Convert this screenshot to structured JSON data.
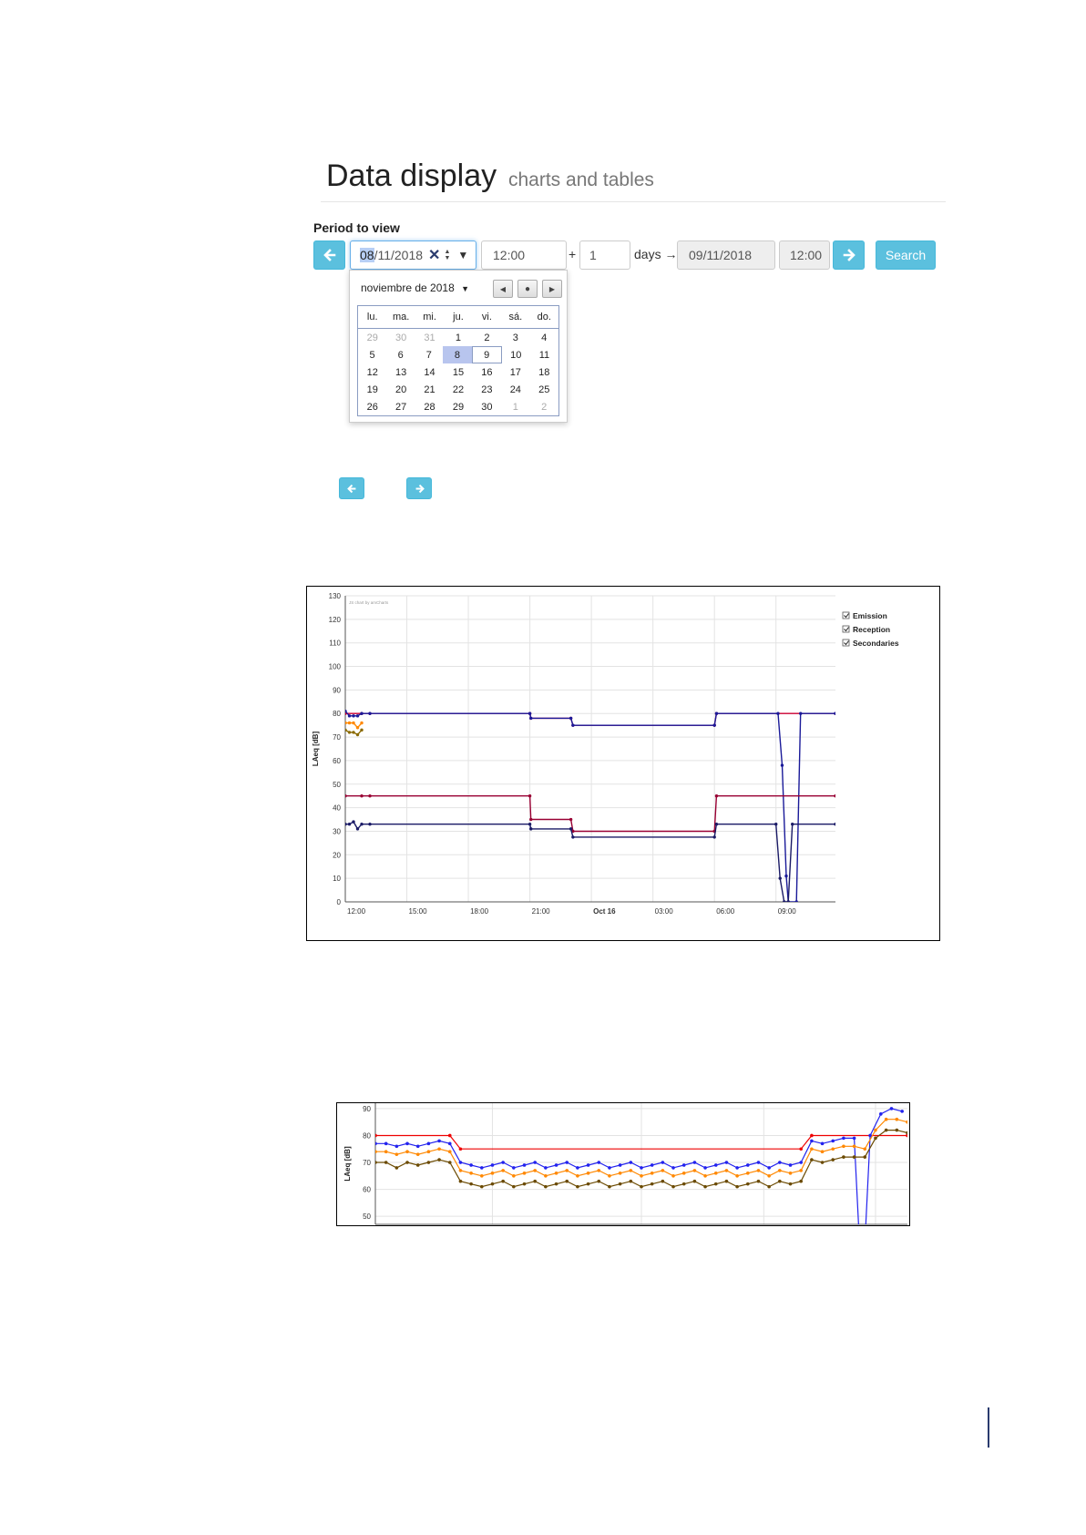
{
  "header": {
    "title": "Data display",
    "subtitle": "charts and tables"
  },
  "period": {
    "label": "Period to view",
    "start_date_prefix": "08",
    "start_date_rest": "/11/2018",
    "start_time": "12:00",
    "plus": "+",
    "days_value": "1",
    "days_label": "days",
    "arrow": "→",
    "end_date": "09/11/2018",
    "end_time": "12:00",
    "search_label": "Search",
    "prev_icon": "arrow-left-icon",
    "next_icon": "arrow-right-icon",
    "accent_color": "#5bc0de"
  },
  "datepicker": {
    "month_label": "noviembre de 2018",
    "weekdays": [
      "lu.",
      "ma.",
      "mi.",
      "ju.",
      "vi.",
      "sá.",
      "do."
    ],
    "weeks": [
      [
        "29",
        "30",
        "31",
        "1",
        "2",
        "3",
        "4"
      ],
      [
        "5",
        "6",
        "7",
        "8",
        "9",
        "10",
        "11"
      ],
      [
        "12",
        "13",
        "14",
        "15",
        "16",
        "17",
        "18"
      ],
      [
        "19",
        "20",
        "21",
        "22",
        "23",
        "24",
        "25"
      ],
      [
        "26",
        "27",
        "28",
        "29",
        "30",
        "1",
        "2"
      ]
    ],
    "selected_day": "8",
    "highlighted_day": "9"
  },
  "chart_data": [
    {
      "type": "line",
      "title": "",
      "credit": "JS chart by amCharts",
      "ylabel": "LAeq [dB]",
      "ylim": [
        0,
        130
      ],
      "yticks": [
        0,
        10,
        20,
        30,
        40,
        50,
        60,
        70,
        80,
        90,
        100,
        110,
        120,
        130
      ],
      "xlim": [
        12.0,
        35.9
      ],
      "xticks": [
        {
          "x": 12,
          "label": "12:00"
        },
        {
          "x": 15,
          "label": "15:00"
        },
        {
          "x": 18,
          "label": "18:00"
        },
        {
          "x": 21,
          "label": "21:00"
        },
        {
          "x": 24,
          "label": "Oct 16"
        },
        {
          "x": 27,
          "label": "03:00"
        },
        {
          "x": 30,
          "label": "06:00"
        },
        {
          "x": 33,
          "label": "09:00"
        }
      ],
      "legend": [
        "Emission",
        "Reception",
        "Secondaries"
      ],
      "legend_position": "right",
      "grid": true,
      "series": [
        {
          "color": "#cc0033",
          "points": [
            [
              12.0,
              80
            ],
            [
              12.8,
              80
            ],
            [
              13.2,
              80
            ],
            [
              21.0,
              80
            ],
            [
              21.05,
              78
            ],
            [
              23.0,
              78
            ],
            [
              23.1,
              75
            ],
            [
              30.0,
              75
            ],
            [
              30.1,
              80
            ],
            [
              35.9,
              80
            ]
          ]
        },
        {
          "color": "#1a1a99",
          "points": [
            [
              12.0,
              81
            ],
            [
              12.2,
              79
            ],
            [
              12.4,
              79
            ],
            [
              12.6,
              79
            ],
            [
              12.8,
              80
            ],
            [
              13.2,
              80
            ],
            [
              21.0,
              80
            ],
            [
              21.05,
              78
            ],
            [
              23.0,
              78
            ],
            [
              23.1,
              75
            ],
            [
              30.0,
              75
            ],
            [
              30.1,
              80
            ],
            [
              33.1,
              80
            ],
            [
              33.3,
              58
            ],
            [
              33.5,
              11
            ],
            [
              33.6,
              0
            ],
            [
              34.0,
              0
            ],
            [
              34.2,
              80
            ],
            [
              35.9,
              80
            ]
          ]
        },
        {
          "color": "#ff8800",
          "points": [
            [
              12.0,
              76
            ],
            [
              12.2,
              76
            ],
            [
              12.4,
              76
            ],
            [
              12.6,
              74
            ],
            [
              12.8,
              76
            ]
          ]
        },
        {
          "color": "#8a6a00",
          "points": [
            [
              12.0,
              73
            ],
            [
              12.2,
              72
            ],
            [
              12.4,
              72
            ],
            [
              12.6,
              71
            ],
            [
              12.8,
              73
            ]
          ]
        },
        {
          "color": "#990033",
          "points": [
            [
              12.0,
              45
            ],
            [
              12.8,
              45
            ],
            [
              13.2,
              45
            ],
            [
              21.0,
              45
            ],
            [
              21.05,
              35
            ],
            [
              23.0,
              35
            ],
            [
              23.1,
              30
            ],
            [
              30.0,
              30
            ],
            [
              30.1,
              45
            ],
            [
              35.9,
              45
            ]
          ]
        },
        {
          "color": "#1a1a66",
          "points": [
            [
              12.0,
              33
            ],
            [
              12.2,
              33
            ],
            [
              12.4,
              34
            ],
            [
              12.6,
              31
            ],
            [
              12.8,
              33
            ],
            [
              13.2,
              33
            ],
            [
              21.0,
              33
            ],
            [
              21.05,
              31
            ],
            [
              23.0,
              31
            ],
            [
              23.1,
              27.5
            ],
            [
              30.0,
              27.5
            ],
            [
              30.1,
              33
            ],
            [
              33.0,
              33
            ],
            [
              33.2,
              10
            ],
            [
              33.4,
              0
            ],
            [
              33.6,
              0
            ],
            [
              33.8,
              33
            ],
            [
              35.9,
              33
            ]
          ]
        }
      ]
    },
    {
      "type": "line",
      "title": "",
      "ylabel": "LAeq [dB]",
      "ylim": [
        47,
        92
      ],
      "yticks": [
        50,
        60,
        70,
        80,
        90
      ],
      "xlim": [
        0,
        100
      ],
      "grid": true,
      "series": [
        {
          "color": "#ee0000",
          "points": [
            [
              0,
              80
            ],
            [
              14,
              80
            ],
            [
              16,
              75
            ],
            [
              80,
              75
            ],
            [
              82,
              80
            ],
            [
              100,
              80
            ]
          ]
        },
        {
          "color": "#2222ee",
          "points": [
            [
              0,
              77
            ],
            [
              2,
              77
            ],
            [
              4,
              76
            ],
            [
              6,
              77
            ],
            [
              8,
              76
            ],
            [
              10,
              77
            ],
            [
              12,
              78
            ],
            [
              14,
              77
            ],
            [
              16,
              70
            ],
            [
              18,
              69
            ],
            [
              20,
              68
            ],
            [
              22,
              69
            ],
            [
              24,
              70
            ],
            [
              26,
              68
            ],
            [
              28,
              69
            ],
            [
              30,
              70
            ],
            [
              32,
              68
            ],
            [
              34,
              69
            ],
            [
              36,
              70
            ],
            [
              38,
              68
            ],
            [
              40,
              69
            ],
            [
              42,
              70
            ],
            [
              44,
              68
            ],
            [
              46,
              69
            ],
            [
              48,
              70
            ],
            [
              50,
              68
            ],
            [
              52,
              69
            ],
            [
              54,
              70
            ],
            [
              56,
              68
            ],
            [
              58,
              69
            ],
            [
              60,
              70
            ],
            [
              62,
              68
            ],
            [
              64,
              69
            ],
            [
              66,
              70
            ],
            [
              68,
              68
            ],
            [
              70,
              69
            ],
            [
              72,
              70
            ],
            [
              74,
              68
            ],
            [
              76,
              70
            ],
            [
              78,
              69
            ],
            [
              80,
              70
            ],
            [
              82,
              78
            ],
            [
              84,
              77
            ],
            [
              86,
              78
            ],
            [
              88,
              79
            ],
            [
              90,
              79
            ],
            [
              91,
              40
            ],
            [
              92,
              40
            ],
            [
              93,
              80
            ],
            [
              95,
              88
            ],
            [
              97,
              90
            ],
            [
              99,
              89
            ]
          ]
        },
        {
          "color": "#ff8800",
          "points": [
            [
              0,
              74
            ],
            [
              2,
              74
            ],
            [
              4,
              73
            ],
            [
              6,
              74
            ],
            [
              8,
              73
            ],
            [
              10,
              74
            ],
            [
              12,
              75
            ],
            [
              14,
              74
            ],
            [
              16,
              67
            ],
            [
              18,
              66
            ],
            [
              20,
              65
            ],
            [
              22,
              66
            ],
            [
              24,
              67
            ],
            [
              26,
              65
            ],
            [
              28,
              66
            ],
            [
              30,
              67
            ],
            [
              32,
              65
            ],
            [
              34,
              66
            ],
            [
              36,
              67
            ],
            [
              38,
              65
            ],
            [
              40,
              66
            ],
            [
              42,
              67
            ],
            [
              44,
              65
            ],
            [
              46,
              66
            ],
            [
              48,
              67
            ],
            [
              50,
              65
            ],
            [
              52,
              66
            ],
            [
              54,
              67
            ],
            [
              56,
              65
            ],
            [
              58,
              66
            ],
            [
              60,
              67
            ],
            [
              62,
              65
            ],
            [
              64,
              66
            ],
            [
              66,
              67
            ],
            [
              68,
              65
            ],
            [
              70,
              66
            ],
            [
              72,
              67
            ],
            [
              74,
              65
            ],
            [
              76,
              67
            ],
            [
              78,
              66
            ],
            [
              80,
              67
            ],
            [
              82,
              75
            ],
            [
              84,
              74
            ],
            [
              86,
              75
            ],
            [
              88,
              76
            ],
            [
              90,
              76
            ],
            [
              92,
              75
            ],
            [
              94,
              82
            ],
            [
              96,
              86
            ],
            [
              98,
              86
            ],
            [
              100,
              85
            ]
          ]
        },
        {
          "color": "#6b4a00",
          "points": [
            [
              0,
              70
            ],
            [
              2,
              70
            ],
            [
              4,
              68
            ],
            [
              6,
              70
            ],
            [
              8,
              69
            ],
            [
              10,
              70
            ],
            [
              12,
              71
            ],
            [
              14,
              70
            ],
            [
              16,
              63
            ],
            [
              18,
              62
            ],
            [
              20,
              61
            ],
            [
              22,
              62
            ],
            [
              24,
              63
            ],
            [
              26,
              61
            ],
            [
              28,
              62
            ],
            [
              30,
              63
            ],
            [
              32,
              61
            ],
            [
              34,
              62
            ],
            [
              36,
              63
            ],
            [
              38,
              61
            ],
            [
              40,
              62
            ],
            [
              42,
              63
            ],
            [
              44,
              61
            ],
            [
              46,
              62
            ],
            [
              48,
              63
            ],
            [
              50,
              61
            ],
            [
              52,
              62
            ],
            [
              54,
              63
            ],
            [
              56,
              61
            ],
            [
              58,
              62
            ],
            [
              60,
              63
            ],
            [
              62,
              61
            ],
            [
              64,
              62
            ],
            [
              66,
              63
            ],
            [
              68,
              61
            ],
            [
              70,
              62
            ],
            [
              72,
              63
            ],
            [
              74,
              61
            ],
            [
              76,
              63
            ],
            [
              78,
              62
            ],
            [
              80,
              63
            ],
            [
              82,
              71
            ],
            [
              84,
              70
            ],
            [
              86,
              71
            ],
            [
              88,
              72
            ],
            [
              90,
              72
            ],
            [
              92,
              72
            ],
            [
              94,
              79
            ],
            [
              96,
              82
            ],
            [
              98,
              82
            ],
            [
              100,
              81
            ]
          ]
        }
      ]
    }
  ]
}
